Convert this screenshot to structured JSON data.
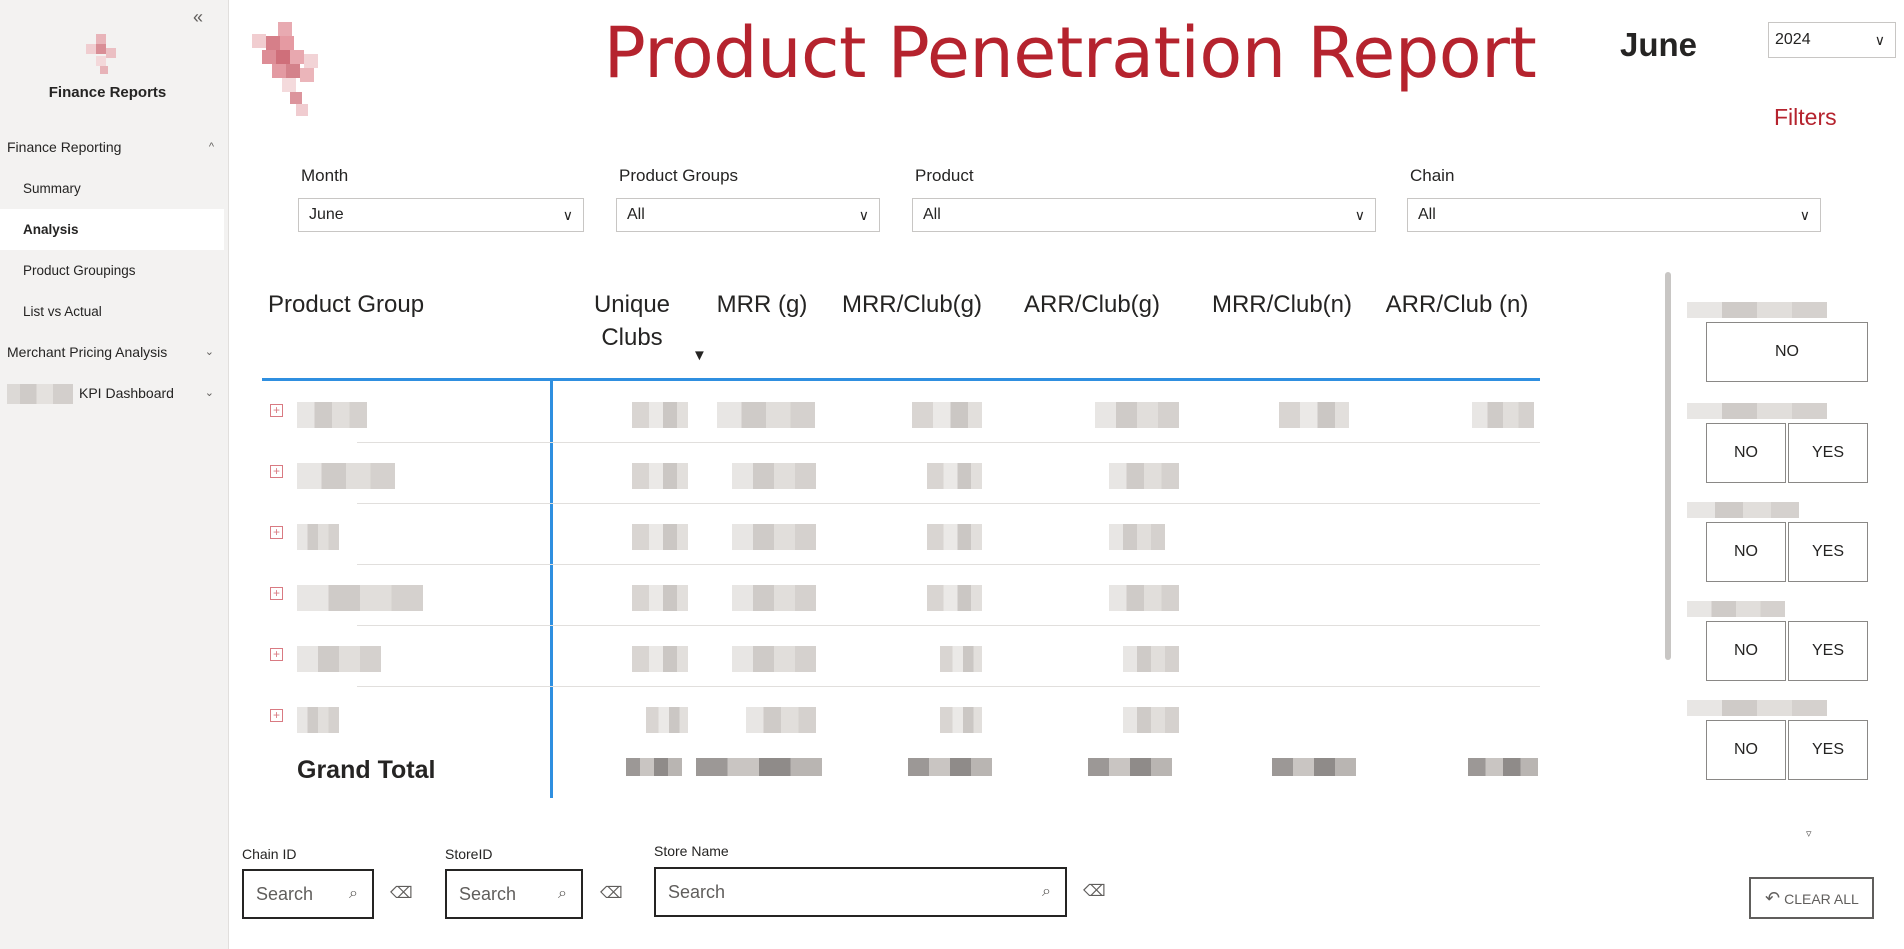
{
  "sidebar": {
    "collapse_icon": "«",
    "title": "Finance Reports",
    "items": [
      {
        "label": "Finance Reporting",
        "chevron": "^"
      },
      {
        "label": "Summary"
      },
      {
        "label": "Analysis"
      },
      {
        "label": "Product Groupings"
      },
      {
        "label": "List vs Actual"
      },
      {
        "label": "Merchant Pricing Analysis",
        "chevron": "⌄"
      },
      {
        "label": "KPI Dashboard",
        "chevron": "⌄"
      }
    ]
  },
  "header": {
    "title": "Product Penetration Report",
    "month": "June",
    "year": "2024",
    "filters_link": "Filters"
  },
  "slicers": [
    {
      "label": "Month",
      "value": "June"
    },
    {
      "label": "Product Groups",
      "value": "All"
    },
    {
      "label": "Product",
      "value": "All"
    },
    {
      "label": "Chain",
      "value": "All"
    }
  ],
  "table": {
    "columns": [
      "Product Group",
      "Unique Clubs",
      "MRR (g)",
      "MRR/Club(g)",
      "ARR/Club(g)",
      "MRR/Club(n)",
      "ARR/Club (n)"
    ],
    "sort_icon": "▼",
    "expand_icon": "+",
    "grand_total": "Grand Total"
  },
  "filter_panel": {
    "toggles": [
      [
        "NO"
      ],
      [
        "NO",
        "YES"
      ],
      [
        "NO",
        "YES"
      ],
      [
        "NO",
        "YES"
      ],
      [
        "NO",
        "YES"
      ]
    ],
    "funnel_icon": "▿",
    "clear_all": "CLEAR ALL",
    "clear_icon": "↶"
  },
  "search": {
    "chain_id": {
      "label": "Chain ID",
      "placeholder": "Search"
    },
    "store_id": {
      "label": "StoreID",
      "placeholder": "Search"
    },
    "store_name": {
      "label": "Store Name",
      "placeholder": "Search"
    },
    "search_icon": "⌕",
    "eraser_icon": "⌫"
  },
  "colors": {
    "accent": "#b5232e",
    "table_line": "#2f8fe0"
  }
}
